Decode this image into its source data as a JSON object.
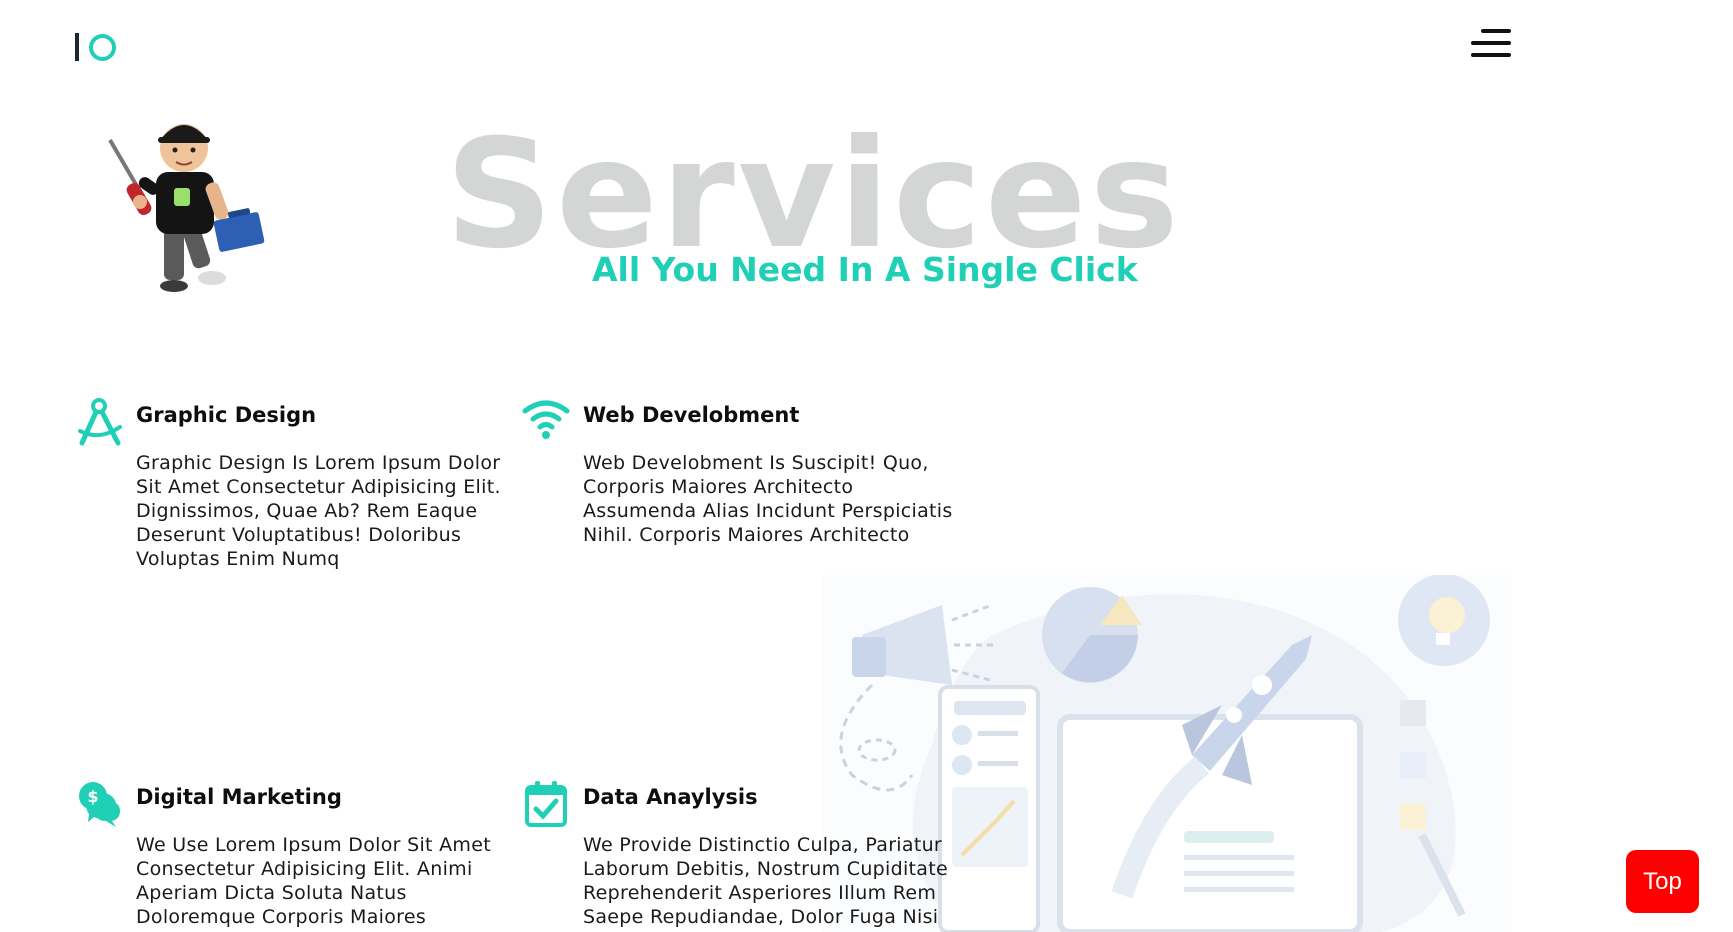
{
  "header": {
    "logo_icon": "io-logo-icon",
    "menu_icon": "hamburger-menu-icon"
  },
  "hero": {
    "title": "Services",
    "subtitle": "All You Need In A Single Click",
    "mascot_icon": "handyman-mascot-illustration"
  },
  "services": [
    {
      "icon": "drafting-compass-icon",
      "title": "Graphic Design",
      "description": "Graphic Design Is Lorem Ipsum Dolor Sit Amet Consectetur Adipisicing Elit. Dignissimos, Quae Ab? Rem Eaque Deserunt Voluptatibus! Doloribus Voluptas Enim Numq"
    },
    {
      "icon": "wifi-icon",
      "title": "Web Develobment",
      "description": "Web Develobment Is Suscipit! Quo, Corporis Maiores Architecto Assumenda Alias Incidunt Perspiciatis Nihil. Corporis Maiores Architecto"
    },
    {
      "icon": "money-chat-icon",
      "title": "Digital Marketing",
      "description": "We Use Lorem Ipsum Dolor Sit Amet Consectetur Adipisicing Elit. Animi Aperiam Dicta Soluta Natus Doloremque Corporis Maiores"
    },
    {
      "icon": "calendar-check-icon",
      "title": "Data Anaylysis",
      "description": "We Provide Distinctio Culpa, Pariatur Laborum Debitis, Nostrum Cupiditate Reprehenderit Asperiores Illum Rem Saepe Repudiandae, Dolor Fuga Nisi"
    }
  ],
  "illustration_icon": "digital-marketing-illustration",
  "top_button": {
    "label": "Top",
    "color": "#ff0000"
  },
  "colors": {
    "accent": "#1fcfb6",
    "hero_title": "#d4d6d6",
    "text": "#111111"
  }
}
